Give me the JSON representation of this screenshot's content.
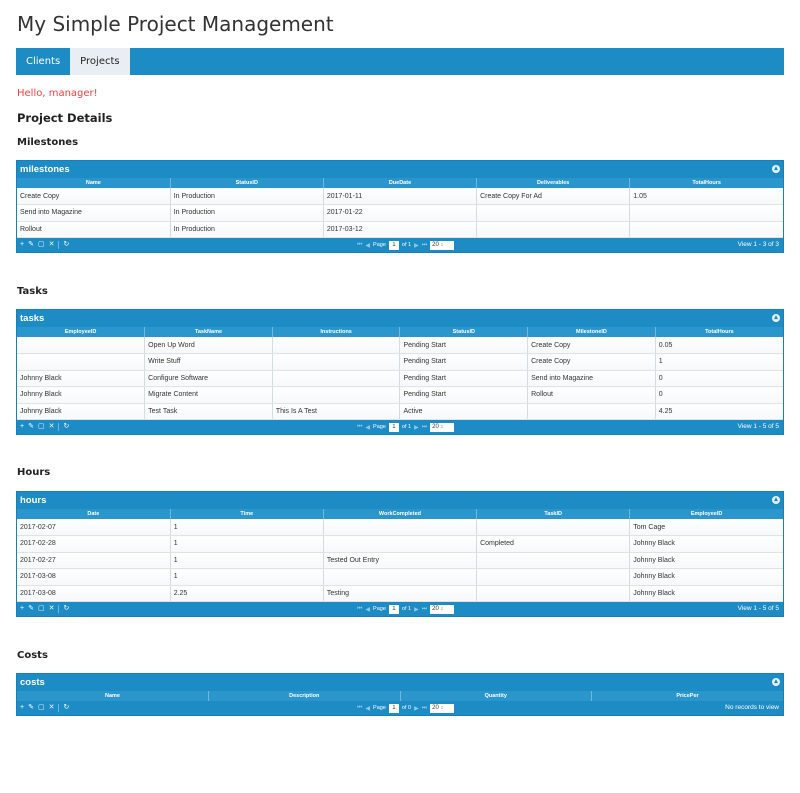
{
  "app": {
    "title": "My Simple Project Management"
  },
  "nav": {
    "tabs": [
      "Clients",
      "Projects"
    ],
    "active": "Projects"
  },
  "greeting": "Hello, manager!",
  "project_details_heading": "Project Details",
  "sections": {
    "milestones": {
      "heading": "Milestones",
      "grid_title": "milestones",
      "columns": [
        "Name",
        "StatusID",
        "DueDate",
        "Deliverables",
        "TotalHours"
      ],
      "rows": [
        [
          "Create Copy",
          "In Production",
          "2017-01-11",
          "Create Copy For Ad",
          "1.05"
        ],
        [
          "Send into Magazine",
          "In Production",
          "2017-01-22",
          "",
          ""
        ],
        [
          "Rollout",
          "In Production",
          "2017-03-12",
          "",
          ""
        ]
      ],
      "pager": {
        "page_label": "Page",
        "page": "1",
        "of_label": "of 1",
        "page_size": "20",
        "record_info": "View 1 - 3 of 3"
      }
    },
    "tasks": {
      "heading": "Tasks",
      "grid_title": "tasks",
      "columns": [
        "EmployeeID",
        "TaskName",
        "Instructions",
        "StatusID",
        "MilestoneID",
        "TotalHours"
      ],
      "rows": [
        [
          "",
          "Open Up Word",
          "",
          "Pending Start",
          "Create Copy",
          "0.05"
        ],
        [
          "",
          "Write Stuff",
          "",
          "Pending Start",
          "Create Copy",
          "1"
        ],
        [
          "Johnny Black",
          "Configure Software",
          "",
          "Pending Start",
          "Send into Magazine",
          "0"
        ],
        [
          "Johnny Black",
          "Migrate Content",
          "",
          "Pending Start",
          "Rollout",
          "0"
        ],
        [
          "Johnny Black",
          "Test Task",
          "This Is A Test",
          "Active",
          "",
          "4.25"
        ]
      ],
      "pager": {
        "page_label": "Page",
        "page": "1",
        "of_label": "of 1",
        "page_size": "20",
        "record_info": "View 1 - 5 of 5"
      }
    },
    "hours": {
      "heading": "Hours",
      "grid_title": "hours",
      "columns": [
        "Date",
        "Time",
        "WorkCompleted",
        "TaskID",
        "EmployeeID"
      ],
      "rows": [
        [
          "2017-02-07",
          "1",
          "",
          "",
          "Tom Cage"
        ],
        [
          "2017-02-28",
          "1",
          "",
          "Completed",
          "Johnny Black"
        ],
        [
          "2017-02-27",
          "1",
          "Tested Out Entry",
          "",
          "Johnny Black"
        ],
        [
          "2017-03-08",
          "1",
          "",
          "",
          "Johnny Black"
        ],
        [
          "2017-03-08",
          "2.25",
          "Testing",
          "",
          "Johnny Black"
        ]
      ],
      "pager": {
        "page_label": "Page",
        "page": "1",
        "of_label": "of 1",
        "page_size": "20",
        "record_info": "View 1 - 5 of 5"
      }
    },
    "costs": {
      "heading": "Costs",
      "grid_title": "costs",
      "columns": [
        "Name",
        "Description",
        "Quantity",
        "PricePer"
      ],
      "rows": [],
      "pager": {
        "page_label": "Page",
        "page": "1",
        "of_label": "of 0",
        "page_size": "20",
        "record_info": "No records to view"
      }
    }
  },
  "toolbar_icons": [
    "add-icon",
    "edit-icon",
    "view-icon",
    "delete-icon",
    "refresh-icon"
  ],
  "colors": {
    "header_blue": "#1d8bc4",
    "greeting_red": "#e8433f",
    "active_tab_bg": "#e8eef3"
  }
}
